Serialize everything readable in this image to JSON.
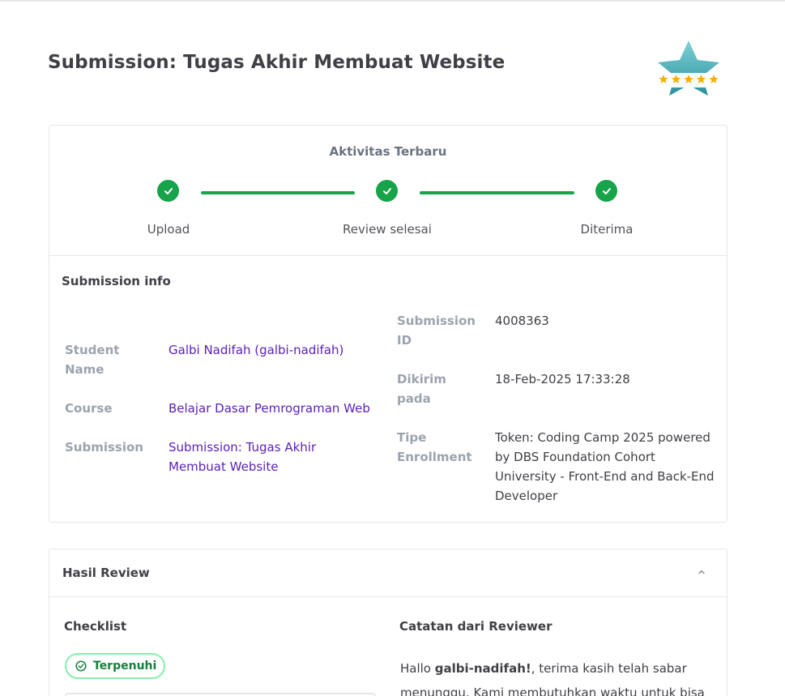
{
  "page": {
    "title": "Submission: Tugas Akhir Membuat Website"
  },
  "activity": {
    "title": "Aktivitas Terbaru",
    "steps": [
      {
        "label": "Upload",
        "done": true
      },
      {
        "label": "Review selesai",
        "done": true
      },
      {
        "label": "Diterima",
        "done": true
      }
    ],
    "accent_color": "#16a34a"
  },
  "info": {
    "title": "Submission info",
    "student_name_label": "Student Name",
    "student_name": "Galbi Nadifah (galbi-nadifah)",
    "course_label": "Course",
    "course": "Belajar Dasar Pemrograman Web",
    "submission_label": "Submission",
    "submission": "Submission: Tugas Akhir Membuat Website",
    "submission_id_label": "Submission ID",
    "submission_id": "4008363",
    "submitted_label": "Dikirim pada",
    "submitted_at": "18-Feb-2025 17:33:28",
    "enrollment_label": "Tipe Enrollment",
    "enrollment": "Token: Coding Camp 2025 powered by DBS Foundation Cohort University - Front-End and Back-End Developer"
  },
  "review": {
    "title": "Hasil Review",
    "checklist_title": "Checklist",
    "status": "Terpenuhi",
    "notes_title": "Catatan dari Reviewer",
    "notes_greeting": "Hallo ",
    "notes_user": "galbi-nadifah!",
    "notes_body": ", terima kasih telah sabar menunggu. Kami membutuhkan waktu untuk bisa"
  },
  "icons": {
    "badge": "rating-star-badge-icon",
    "step": "check-circle-icon",
    "collapse": "chevron-up-icon",
    "status": "check-circle-outline-icon"
  }
}
